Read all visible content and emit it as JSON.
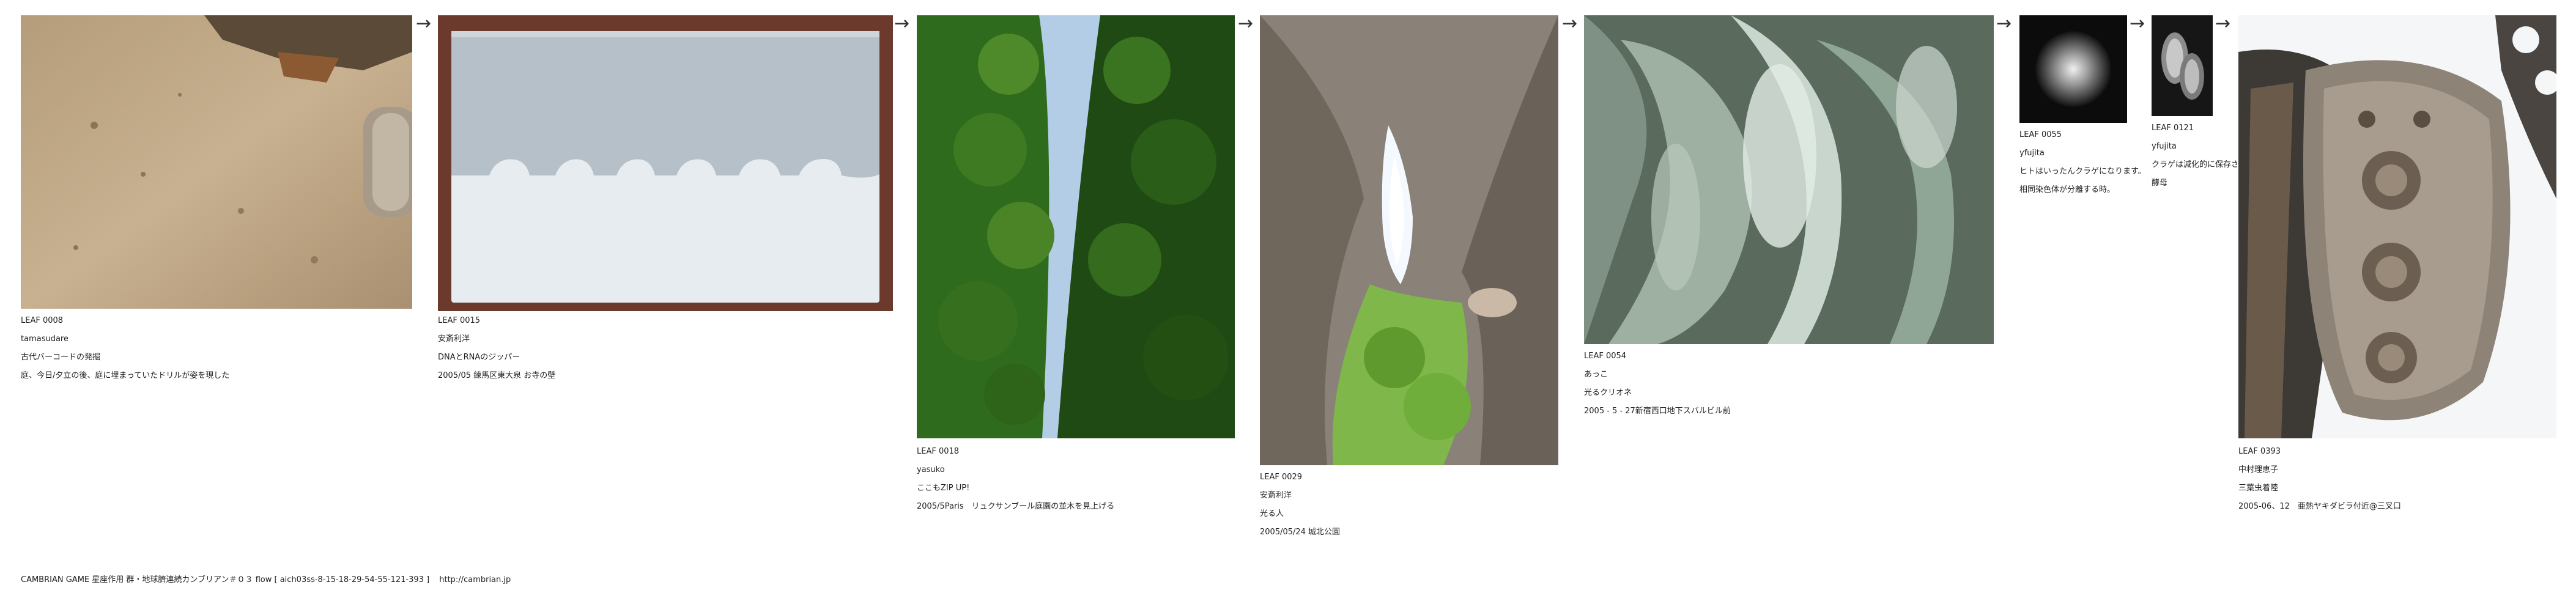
{
  "leaves": [
    {
      "id": "LEAF 0008",
      "author": "tamasudare",
      "title": "古代バーコードの発掘",
      "notes": [
        "庭、今日/夕立の後、庭に埋まっていたドリルが姿を現した"
      ]
    },
    {
      "id": "LEAF 0015",
      "author": "安斎利洋",
      "title": "DNAとRNAのジッパー",
      "notes": [
        "2005/05 練馬区東大泉 お寺の壁"
      ]
    },
    {
      "id": "LEAF 0018",
      "author": "yasuko",
      "title": "ここもZIP UP!",
      "notes": [
        "2005/5Paris　リュクサンブール庭園の並木を見上げる"
      ]
    },
    {
      "id": "LEAF 0029",
      "author": "安斎利洋",
      "title": "光る人",
      "notes": [
        "2005/05/24 城北公園"
      ]
    },
    {
      "id": "LEAF 0054",
      "author": "あっこ",
      "title": "光るクリオネ",
      "notes": [
        "2005 - 5 - 27新宿西口地下スバルビル前"
      ]
    },
    {
      "id": "LEAF 0055",
      "author": "yfujita",
      "title": "ヒトはいったんクラゲになります。",
      "notes": [
        "相同染色体が分離する時。"
      ]
    },
    {
      "id": "LEAF 0121",
      "author": "yfujita",
      "title": "クラゲは減化的に保存さ",
      "notes": [
        "酵母"
      ]
    },
    {
      "id": "LEAF 0393",
      "author": "中村理恵子",
      "title": "三葉虫着陸",
      "notes": [
        "2005-06、12　亜熱ヤキダビラ付近@三叉口"
      ]
    }
  ],
  "arrow_glyph": "→",
  "footer": {
    "text": "CAMBRIAN GAME  星座作用 群・地球臍連続カンブリアン＃０３ flow [ aich03ss-8-15-18-29-54-55-121-393 ]",
    "url": "http://cambrian.jp"
  }
}
